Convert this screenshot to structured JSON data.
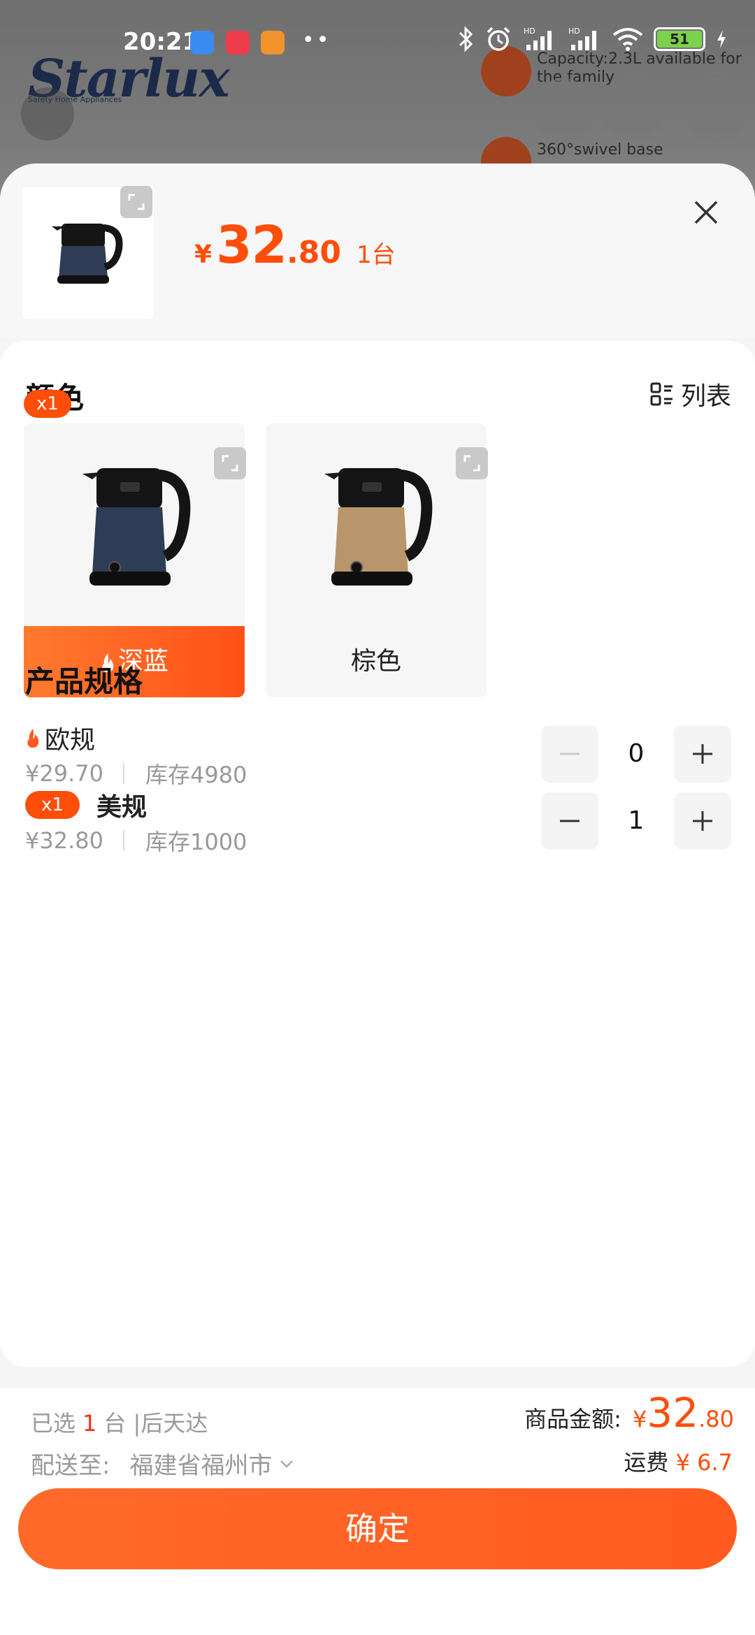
{
  "status_bar": {
    "time": "20:21",
    "battery": "51"
  },
  "background_page": {
    "brand": "Starlux",
    "brand_sub": "Safety Home Appliances",
    "feature_1": "Capacity:2.3L available for the family",
    "feature_2": "360°swivel base"
  },
  "header": {
    "currency": "¥",
    "price_int": "32",
    "price_dec": ".80",
    "quantity": "1台"
  },
  "color_section": {
    "title": "颜色",
    "list_toggle": "列表",
    "options": [
      {
        "label": "深蓝",
        "badge": "x1",
        "selected": true,
        "body_color": "#2e3d55"
      },
      {
        "label": "棕色",
        "badge": "",
        "selected": false,
        "body_color": "#b8956a"
      }
    ]
  },
  "spec_section": {
    "title": "产品规格",
    "items": [
      {
        "name": "欧规",
        "price": "¥29.70",
        "stock": "库存4980",
        "quantity": "0",
        "badge": ""
      },
      {
        "name": "美规",
        "price": "¥32.80",
        "stock": "库存1000",
        "quantity": "1",
        "badge": "x1"
      }
    ]
  },
  "footer": {
    "selected_prefix": "已选",
    "selected_count": "1",
    "selected_suffix": "台 |后天达",
    "delivery_label": "配送至:",
    "delivery_location": "福建省福州市",
    "amount_label": "商品金额:",
    "amount_currency": "¥",
    "amount_int": "32",
    "amount_dec": ".80",
    "shipping_label": "运费",
    "shipping_value": "¥ 6.7",
    "confirm": "确定"
  },
  "colors": {
    "accent": "#ff5a1f",
    "price": "#ff4d0a"
  }
}
